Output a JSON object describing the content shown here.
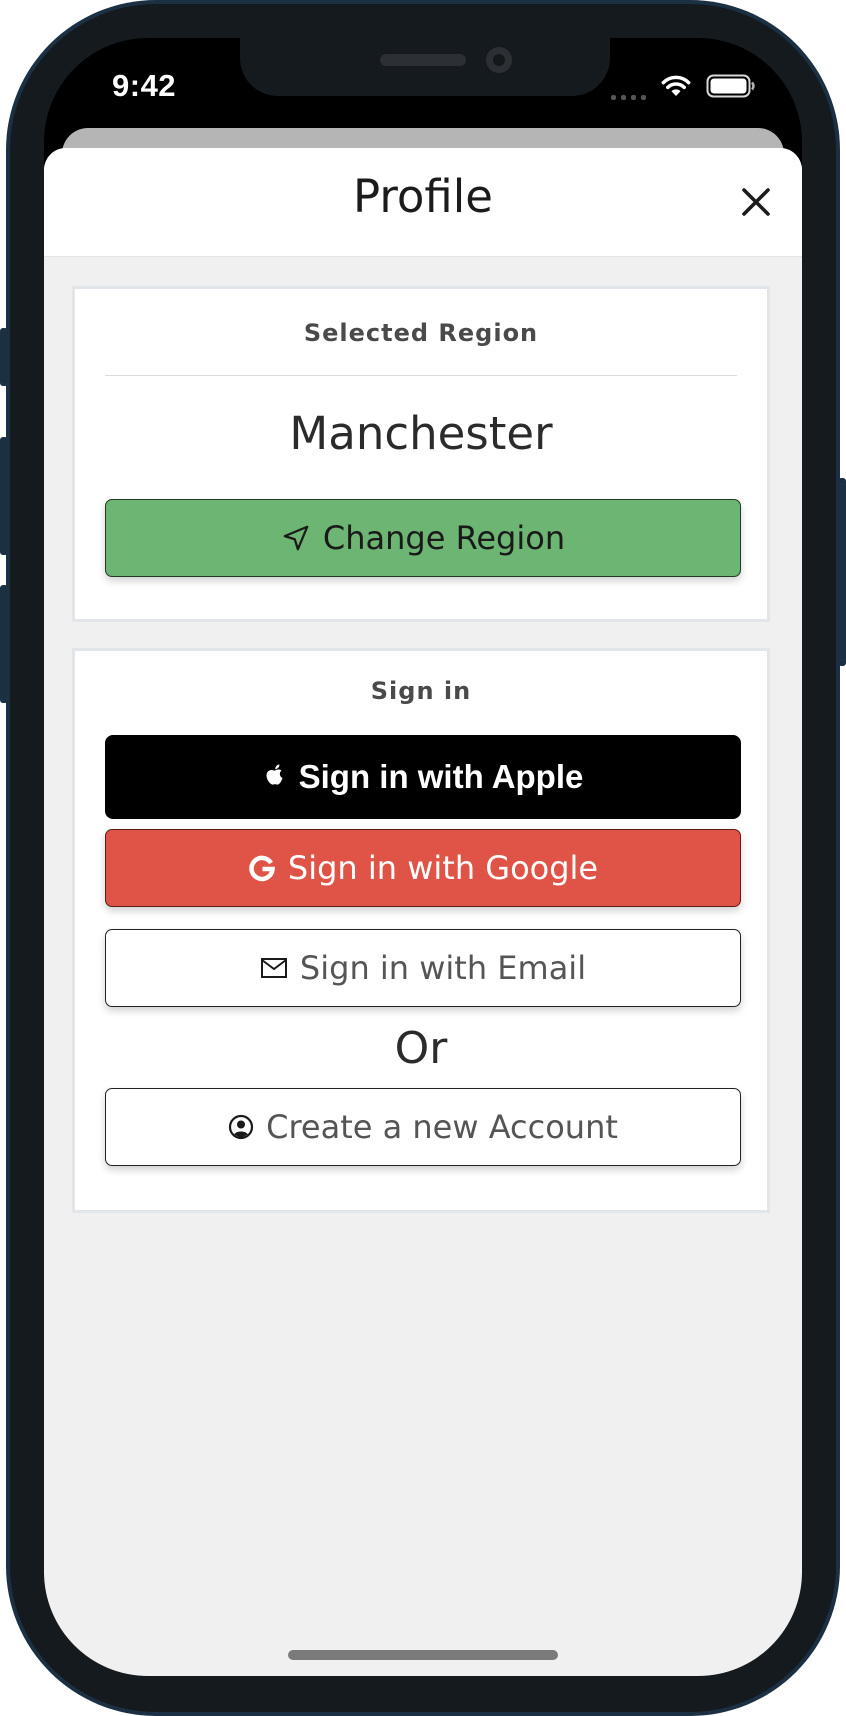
{
  "status_bar": {
    "time": "9:42"
  },
  "header": {
    "title": "Profile"
  },
  "region_card": {
    "title": "Selected Region",
    "region_name": "Manchester",
    "change_button_label": "Change Region"
  },
  "signin_card": {
    "title": "Sign in",
    "apple_label": "Sign in with Apple",
    "google_label": "Sign in with Google",
    "email_label": "Sign in with Email",
    "or_label": "Or",
    "create_label": "Create a new Account"
  },
  "icons": {
    "close": "close-icon",
    "navigation": "navigation-arrow-icon",
    "apple": "apple-icon",
    "google": "google-icon",
    "email": "envelope-icon",
    "account": "user-circle-icon"
  },
  "colors": {
    "region_button": "#6db573",
    "google_button": "#df5446",
    "apple_button": "#000000",
    "sheet_background": "#f0f0f0"
  }
}
